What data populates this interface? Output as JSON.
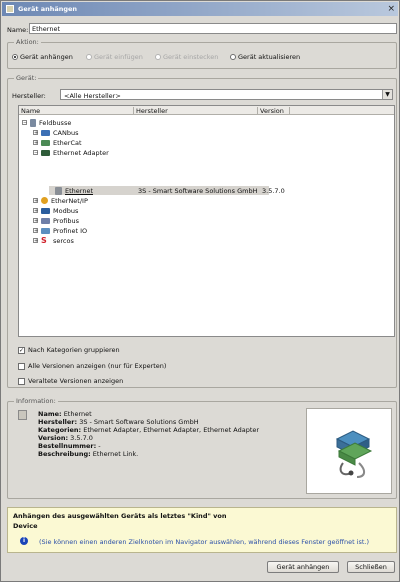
{
  "window": {
    "title": "Gerät anhängen",
    "close_glyph": "×"
  },
  "name_field": {
    "label": "Name:",
    "value": "Ethernet"
  },
  "action_group": {
    "title": "Aktion:",
    "options": [
      {
        "label": "Gerät anhängen",
        "selected": true,
        "enabled": true
      },
      {
        "label": "Gerät einfügen",
        "selected": false,
        "enabled": false
      },
      {
        "label": "Gerät einstecken",
        "selected": false,
        "enabled": false
      },
      {
        "label": "Gerät aktualisieren",
        "selected": false,
        "enabled": true
      }
    ]
  },
  "device_group": {
    "title": "Gerät:",
    "manufacturer_label": "Hersteller:",
    "manufacturer_value": "<Alle Hersteller>",
    "columns": [
      "Name",
      "Hersteller",
      "Version"
    ],
    "tree": [
      {
        "label": "Feldbusse",
        "exp": "−",
        "icon": "fieldbus-icon"
      },
      {
        "label": "CANbus",
        "exp": "+",
        "icon": "canbus-icon"
      },
      {
        "label": "EtherCat",
        "exp": "+",
        "icon": "ethercat-icon"
      },
      {
        "label": "Ethernet Adapter",
        "exp": "−",
        "icon": "ethernet-adapter-icon"
      },
      {
        "label": "Ethernet",
        "exp": "",
        "icon": "device-icon",
        "manufacturer": "3S - Smart Software Solutions GmbH",
        "version": "3.5.7.0",
        "selected": true
      },
      {
        "label": "EtherNet/IP",
        "exp": "+",
        "icon": "ethernet-ip-icon"
      },
      {
        "label": "Modbus",
        "exp": "+",
        "icon": "modbus-icon"
      },
      {
        "label": "Profibus",
        "exp": "+",
        "icon": "profibus-icon"
      },
      {
        "label": "Profinet IO",
        "exp": "+",
        "icon": "profinet-icon"
      },
      {
        "label": "sercos",
        "exp": "+",
        "icon": "sercos-icon"
      }
    ],
    "checkboxes": [
      {
        "label": "Nach Kategorien gruppieren",
        "checked": true
      },
      {
        "label": "Alle Versionen anzeigen (nur für Experten)",
        "checked": false
      },
      {
        "label": "Veraltete Versionen anzeigen",
        "checked": false
      }
    ]
  },
  "information": {
    "title": "Information:",
    "lines": [
      {
        "key": "Name:",
        "value": "Ethernet"
      },
      {
        "key": "Hersteller:",
        "value": "3S - Smart Software Solutions GmbH"
      },
      {
        "key": "Kategorien:",
        "value": "Ethernet Adapter, Ethernet Adapter, Ethernet Adapter"
      },
      {
        "key": "Version:",
        "value": "3.5.7.0"
      },
      {
        "key": "Bestellnummer:",
        "value": "-"
      },
      {
        "key": "Beschreibung:",
        "value": "Ethernet Link."
      }
    ]
  },
  "hint": {
    "heading": "Anhängen des ausgewählten Geräts als letztes \"Kind\" von",
    "target": "Device",
    "info_icon": "i",
    "note": "(Sie können einen anderen Zielknoten im Navigator auswählen, während dieses Fenster geöffnet ist.)"
  },
  "buttons": {
    "attach": "Gerät anhängen",
    "close": "Schließen"
  },
  "colors": {
    "title_bar": "#6d88b4",
    "hint_bg": "#fbf9d3",
    "info_blue": "#1a44b8",
    "note_blue": "#2b4fa8"
  }
}
